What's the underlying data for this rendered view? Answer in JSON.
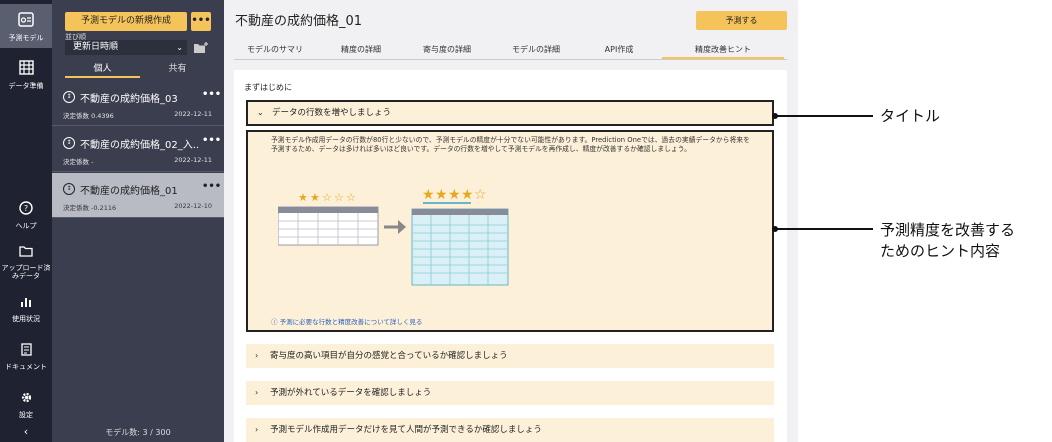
{
  "rail": {
    "items": [
      {
        "label": "予測モデル",
        "icon": "model-icon"
      },
      {
        "label": "データ準備",
        "icon": "data-icon"
      },
      {
        "label": "ヘルプ",
        "icon": "help-icon"
      },
      {
        "label": "アップロード済みデータ",
        "icon": "folder-icon"
      },
      {
        "label": "使用状況",
        "icon": "usage-icon"
      },
      {
        "label": "ドキュメント",
        "icon": "document-icon"
      },
      {
        "label": "設定",
        "icon": "gear-icon"
      }
    ],
    "collapse": "‹"
  },
  "list": {
    "new_label": "予測モデルの新規作成",
    "more": "•••",
    "sort_label": "並び順",
    "sort_value": "更新日時順",
    "tabs": [
      "個人",
      "共有"
    ],
    "models": [
      {
        "name": "不動産の成約価格_03",
        "score": "決定係数 0.4396",
        "date": "2022-12-11"
      },
      {
        "name": "不動産の成約価格_02_入...",
        "score": "決定係数 -",
        "date": "2022-12-11"
      },
      {
        "name": "不動産の成約価格_01",
        "score": "決定係数 -0.2116",
        "date": "2022-12-10"
      }
    ],
    "count": "モデル数: 3 / 300"
  },
  "main": {
    "title": "不動産の成約価格_01",
    "predict_label": "予測する",
    "tabs": [
      "モデルのサマリ",
      "精度の詳細",
      "寄与度の詳細",
      "モデルの詳細",
      "API作成",
      "精度改善ヒント"
    ],
    "intro": "まずはじめに",
    "acc1": "データの行数を増やしましょう",
    "hint_text": "予測モデル作成用データの行数が80行と少ないので、予測モデルの精度が十分でない可能性があります。Prediction Oneでは、過去の実績データから将来を予測するため、データは多ければ多いほど良いです。データの行数を増やして予測モデルを再作成し、精度が改善するか確認しましょう。",
    "hint_link": "予測に必要な行数と精度改善について詳しく見る",
    "acc2": "寄与度の高い項目が自分の感覚と合っているか確認しましょう",
    "acc3": "予測が外れているデータを確認しましょう",
    "acc4": "予測モデル作成用データだけを見て人間が予測できるか確認しましょう"
  },
  "callouts": {
    "title": "タイトル",
    "hint_1": "予測精度を改善する",
    "hint_2": "ためのヒント内容"
  },
  "illustration": {
    "before_stars": 2,
    "after_stars": 4,
    "max_stars": 5
  }
}
